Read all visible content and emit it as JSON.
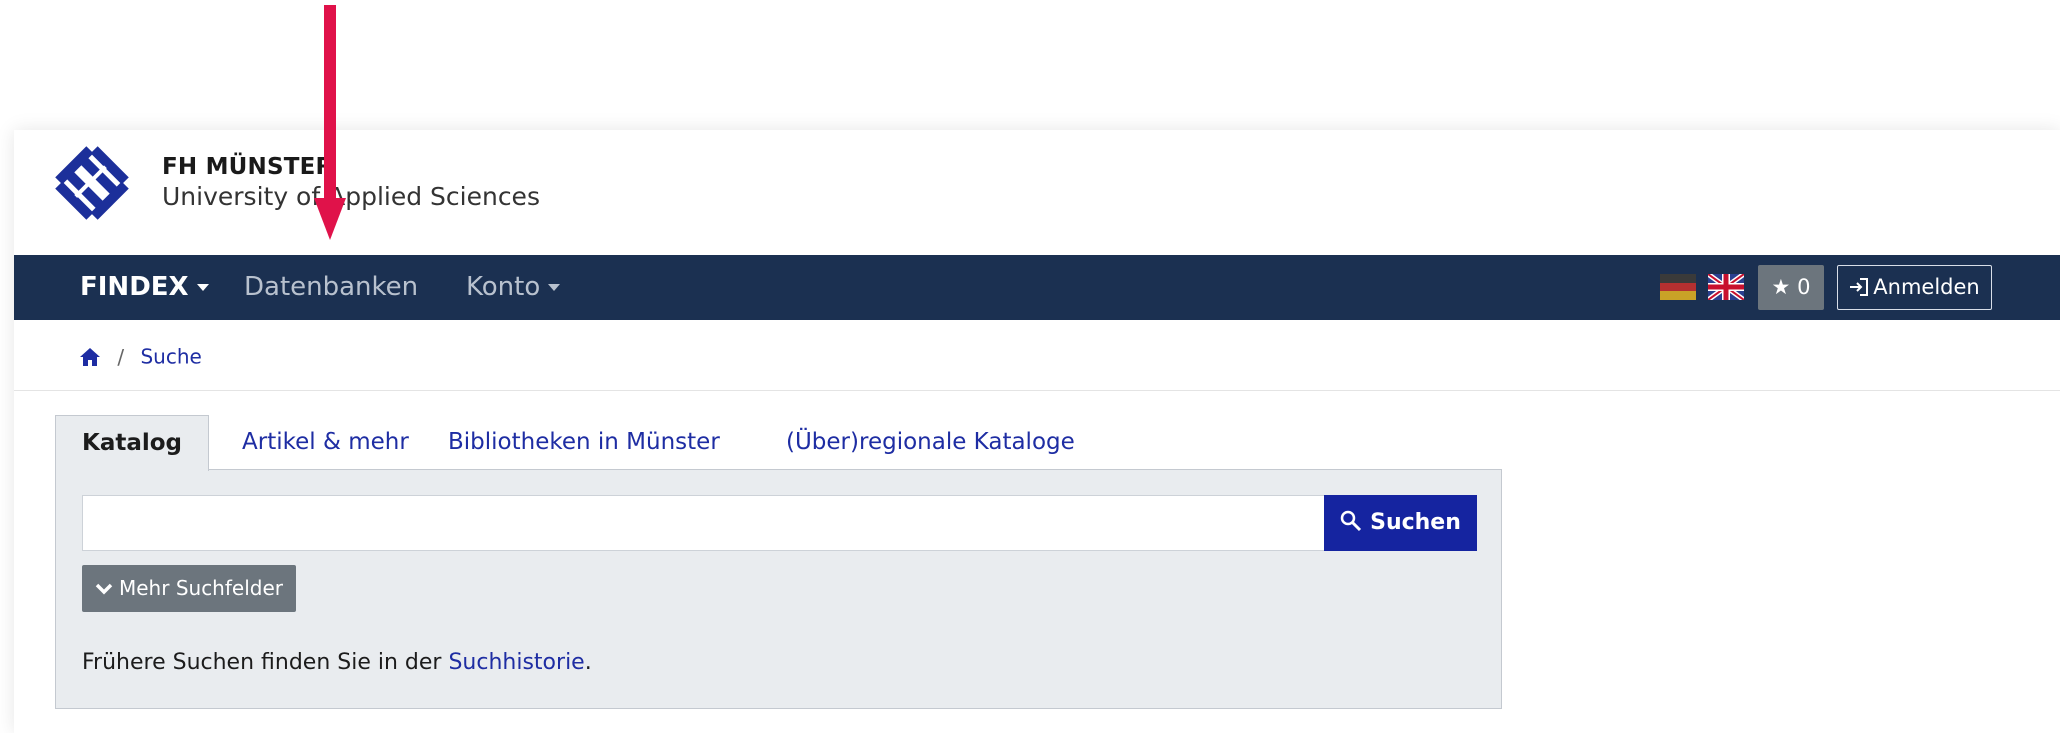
{
  "header": {
    "logo_line1": "FH MÜNSTER",
    "logo_line2": "University of Applied Sciences"
  },
  "nav": {
    "items": [
      {
        "label": "FINDEX",
        "dropdown": true,
        "active": true
      },
      {
        "label": "Datenbanken",
        "dropdown": false,
        "active": false
      },
      {
        "label": "Konto",
        "dropdown": true,
        "active": false
      }
    ],
    "languages": [
      "de",
      "en"
    ],
    "watchlist_count": "0",
    "login_label": "Anmelden"
  },
  "breadcrumb": {
    "home_icon": "home-icon",
    "current": "Suche"
  },
  "tabs": [
    {
      "label": "Katalog",
      "active": true
    },
    {
      "label": "Artikel & mehr",
      "active": false
    },
    {
      "label": "Bibliotheken in Münster",
      "active": false
    },
    {
      "label": "(Über)regionale Kataloge",
      "active": false
    }
  ],
  "search": {
    "value": "",
    "button_label": "Suchen",
    "more_fields_label": "Mehr Suchfelder",
    "history_prefix": "Frühere Suchen finden Sie in der ",
    "history_link": "Suchhistorie",
    "history_suffix": "."
  },
  "colors": {
    "navbar": "#1b3051",
    "primary": "#1524a0",
    "link": "#1e2da3",
    "secondary_button": "#6c757d",
    "panel_bg": "#e9ecef",
    "annotation_arrow": "#e0124a"
  }
}
